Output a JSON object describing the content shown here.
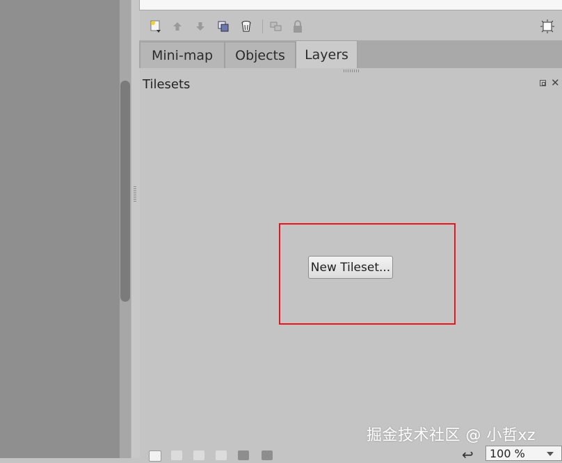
{
  "tabs": [
    {
      "label": "Mini-map",
      "active": false
    },
    {
      "label": "Objects",
      "active": false
    },
    {
      "label": "Layers",
      "active": true
    }
  ],
  "toolbar": {
    "icons": [
      "new-layer-icon",
      "raise-layer-icon",
      "lower-layer-icon",
      "duplicate-layer-icon",
      "remove-layer-icon",
      "toggle-visibility-icon",
      "lock-icon",
      "highlight-layer-icon"
    ]
  },
  "tilesets_panel": {
    "title": "Tilesets",
    "new_tileset_button": "New Tileset..."
  },
  "zoom": {
    "value": "100 %"
  },
  "watermark": "掘金技术社区 @ 小哲xz",
  "colors": {
    "highlight": "#e8131b",
    "panel_bg": "#c4c4c4",
    "canvas_bg": "#8f8f8f"
  }
}
